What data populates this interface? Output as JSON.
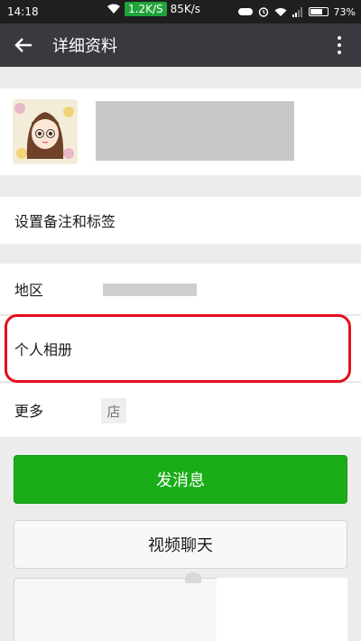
{
  "status_bar": {
    "time": "14:18",
    "speed_badge": "1.2K/S",
    "speed_secondary": "85K/s",
    "battery": "73%"
  },
  "header": {
    "title": "详细资料"
  },
  "rows": {
    "remark_label": "设置备注和标签",
    "region_label": "地区",
    "album_label": "个人相册",
    "more_label": "更多",
    "store_glyph": "店"
  },
  "buttons": {
    "send": "发消息",
    "video": "视频聊天"
  },
  "colors": {
    "title_bar": "#393a3f",
    "send_button": "#1aad19",
    "highlight": "#e3101b",
    "status_bar": "#1f1f1f"
  },
  "icons": [
    "back-arrow-icon",
    "more-vertical-icon",
    "wifi-icon",
    "bluetooth-icon",
    "alarm-icon",
    "signal-icon",
    "battery-icon",
    "store-icon"
  ],
  "battery_level": 0.73
}
